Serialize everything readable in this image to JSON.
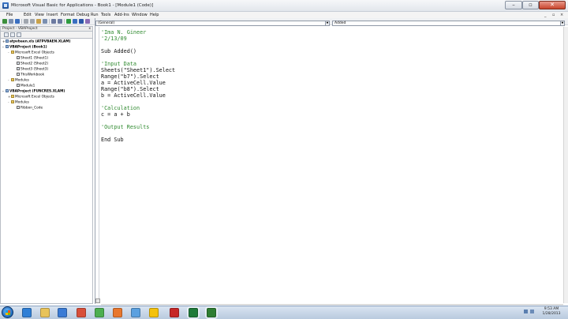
{
  "window": {
    "title": "Microsoft Visual Basic for Applications - Book1 - [Module1 (Code)]",
    "minimize_label": "–",
    "maximize_label": "▫",
    "close_label": "✕"
  },
  "menu": {
    "items": [
      "File",
      "Edit",
      "View",
      "Insert",
      "Format",
      "Debug",
      "Run",
      "Tools",
      "Add-Ins",
      "Window",
      "Help"
    ],
    "mdi_controls": [
      "_",
      "▫",
      "×"
    ]
  },
  "project_explorer": {
    "title": "Project - VBAProject",
    "close_label": "x",
    "tree": [
      {
        "label": "atpvbaen.xls (ATPVBAEN.XLAM)",
        "level": 0,
        "type": "proj",
        "bold": true,
        "toggle": "+"
      },
      {
        "label": "VBAProject (Book1)",
        "level": 0,
        "type": "proj",
        "bold": true,
        "toggle": "-"
      },
      {
        "label": "Microsoft Excel Objects",
        "level": 1,
        "type": "folder",
        "bold": false,
        "toggle": "-"
      },
      {
        "label": "Sheet1 (Sheet1)",
        "level": 2,
        "type": "item",
        "bold": false,
        "toggle": ""
      },
      {
        "label": "Sheet2 (Sheet2)",
        "level": 2,
        "type": "item",
        "bold": false,
        "toggle": ""
      },
      {
        "label": "Sheet3 (Sheet3)",
        "level": 2,
        "type": "item",
        "bold": false,
        "toggle": ""
      },
      {
        "label": "ThisWorkbook",
        "level": 2,
        "type": "item",
        "bold": false,
        "toggle": ""
      },
      {
        "label": "Modules",
        "level": 1,
        "type": "folder",
        "bold": false,
        "toggle": "-"
      },
      {
        "label": "Module1",
        "level": 2,
        "type": "item",
        "bold": false,
        "toggle": ""
      },
      {
        "label": "VBAProject (FUNCRES.XLAM)",
        "level": 0,
        "type": "proj",
        "bold": true,
        "toggle": "-"
      },
      {
        "label": "Microsoft Excel Objects",
        "level": 1,
        "type": "folder",
        "bold": false,
        "toggle": "+"
      },
      {
        "label": "Modules",
        "level": 1,
        "type": "folder",
        "bold": false,
        "toggle": "-"
      },
      {
        "label": "Ribbon_Code",
        "level": 2,
        "type": "item",
        "bold": false,
        "toggle": ""
      }
    ]
  },
  "code_window": {
    "object_combo": "(General)",
    "procedure_combo": "Added",
    "lines": [
      {
        "text": "'Ima N. Gineer",
        "kind": "comment"
      },
      {
        "text": "'2/13/09",
        "kind": "comment"
      },
      {
        "text": "",
        "kind": "plain"
      },
      {
        "text": "Sub Added()",
        "kind": "plain"
      },
      {
        "text": "",
        "kind": "plain"
      },
      {
        "text": "'Input Data",
        "kind": "comment"
      },
      {
        "text": "Sheets(\"Sheet1\").Select",
        "kind": "plain"
      },
      {
        "text": "Range(\"b7\").Select",
        "kind": "plain"
      },
      {
        "text": "a = ActiveCell.Value",
        "kind": "plain"
      },
      {
        "text": "Range(\"b8\").Select",
        "kind": "plain"
      },
      {
        "text": "b = ActiveCell.Value",
        "kind": "plain"
      },
      {
        "text": "",
        "kind": "plain"
      },
      {
        "text": "'Calculation",
        "kind": "comment"
      },
      {
        "text": "c = a + b",
        "kind": "plain"
      },
      {
        "text": "",
        "kind": "plain"
      },
      {
        "text": "'Output Results",
        "kind": "comment"
      },
      {
        "text": "",
        "kind": "plain"
      },
      {
        "text": "End Sub",
        "kind": "plain"
      }
    ]
  },
  "taskbar": {
    "apps": [
      {
        "name": "internet-explorer-icon",
        "color": "#2f7fd6"
      },
      {
        "name": "windows-explorer-icon",
        "color": "#e8c35a"
      },
      {
        "name": "media-player-icon",
        "color": "#3a7bd5"
      },
      {
        "name": "paint-icon",
        "color": "#d84f3a"
      },
      {
        "name": "chrome-icon",
        "color": "#4caf50"
      },
      {
        "name": "firefox-icon",
        "color": "#e8772e"
      },
      {
        "name": "messenger-icon",
        "color": "#5aa0e0"
      },
      {
        "name": "chrome-icon-2",
        "color": "#f4c20d"
      },
      {
        "name": "acrobat-icon",
        "color": "#c62828"
      },
      {
        "name": "excel-icon",
        "color": "#1f7a3a"
      },
      {
        "name": "vba-editor-icon",
        "color": "#2e7d32"
      }
    ],
    "clock_time": "9:53 AM",
    "clock_date": "1/28/2013"
  },
  "colors": {
    "comment": "#2f8a2f",
    "code_text": "#111111",
    "accent": "#1966b8"
  }
}
